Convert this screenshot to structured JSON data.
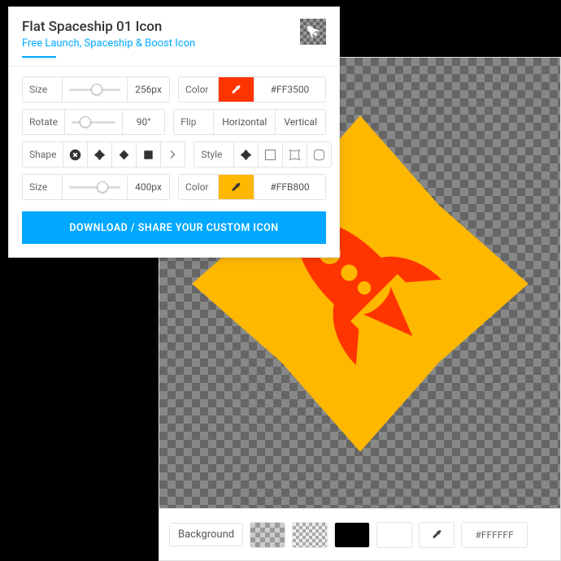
{
  "panel": {
    "title": "Flat Spaceship 01 Icon",
    "subtitle": "Free Launch, Spaceship & Boost Icon",
    "size1": {
      "label": "Size",
      "value": "256px",
      "percent": 55
    },
    "color1": {
      "label": "Color",
      "hex": "#FF3500"
    },
    "rotate": {
      "label": "Rotate",
      "value": "90°",
      "percent": 25
    },
    "flip": {
      "label": "Flip",
      "h": "Horizontal",
      "v": "Vertical"
    },
    "shape": {
      "label": "Shape"
    },
    "style": {
      "label": "Style"
    },
    "size2": {
      "label": "Size",
      "value": "400px",
      "percent": 70
    },
    "color2": {
      "label": "Color",
      "hex": "#FFB800"
    },
    "download": "DOWNLOAD / SHARE YOUR CUSTOM ICON"
  },
  "bgbar": {
    "label": "Background",
    "hex": "#FFFFFF"
  },
  "colors": {
    "accent": "#00a8ff",
    "icon": "#FF3500",
    "shape": "#FFB800"
  }
}
